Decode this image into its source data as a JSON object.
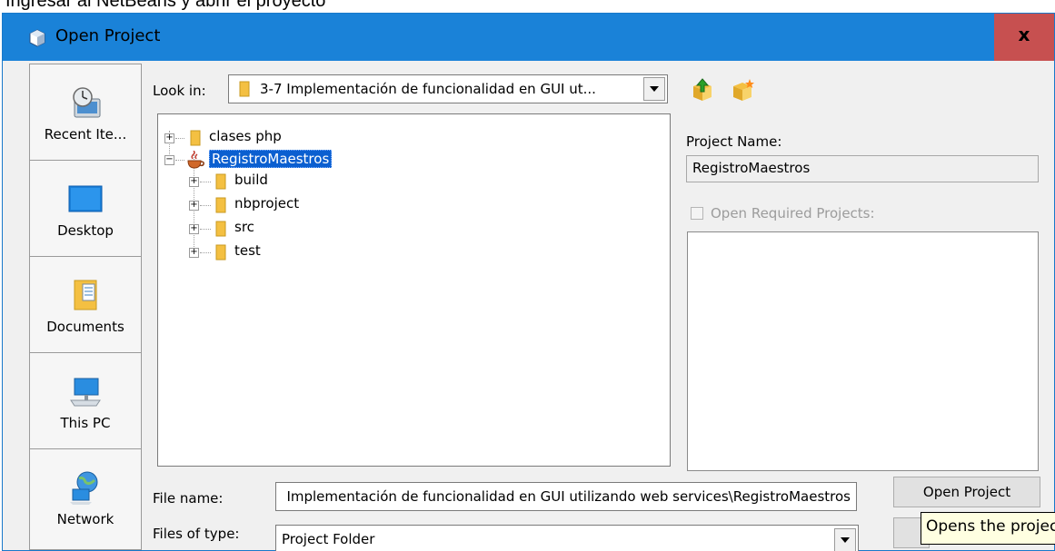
{
  "top_strip_text": "Ingresar al NetBeans y abrir el proyecto",
  "window": {
    "title": "Open Project",
    "close_glyph": "x"
  },
  "places": [
    {
      "label": "Recent Ite...",
      "icon": "recent-items-icon"
    },
    {
      "label": "Desktop",
      "icon": "desktop-icon"
    },
    {
      "label": "Documents",
      "icon": "documents-icon"
    },
    {
      "label": "This PC",
      "icon": "this-pc-icon"
    },
    {
      "label": "Network",
      "icon": "network-icon"
    }
  ],
  "look_in": {
    "label": "Look in:",
    "value": "3-7 Implementación de funcionalidad en GUI ut..."
  },
  "tree": {
    "items": [
      {
        "label": "clases php"
      },
      {
        "label": "RegistroMaestros"
      },
      {
        "label": "build"
      },
      {
        "label": "nbproject"
      },
      {
        "label": "src"
      },
      {
        "label": "test"
      }
    ]
  },
  "project_name": {
    "label": "Project Name:",
    "value": "RegistroMaestros"
  },
  "open_required": {
    "label": "Open Required Projects:",
    "checked": false
  },
  "file_name": {
    "label": "File name:",
    "value": "Implementación de funcionalidad en GUI utilizando web services\\RegistroMaestros"
  },
  "files_of_type": {
    "label": "Files of type:",
    "value": "Project Folder"
  },
  "buttons": {
    "open_project": "Open Project"
  },
  "tooltip": "Opens the project",
  "colors": {
    "titlebar": "#1a82d8",
    "close": "#c75050",
    "selection": "#0b5fd0",
    "folder": "#f4c042"
  }
}
